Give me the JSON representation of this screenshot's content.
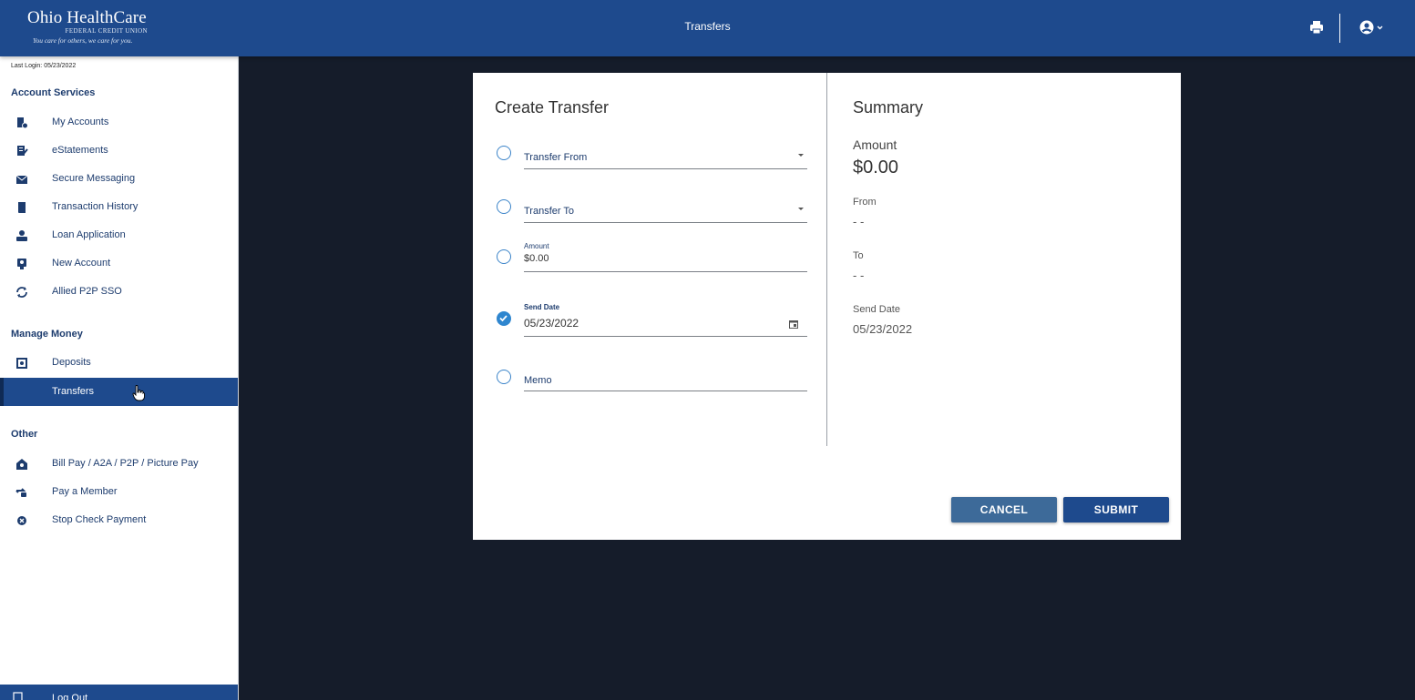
{
  "header": {
    "logo_main": "Ohio HealthCare",
    "logo_sub": "FEDERAL CREDIT UNION",
    "logo_tagline": "You care for others, we care for you.",
    "title": "Transfers",
    "print_icon": "print-icon",
    "account_icon": "account-circle-icon"
  },
  "sidebar": {
    "last_login": "Last Login: 05/23/2022",
    "sections": [
      {
        "title": "Account Services",
        "items": [
          {
            "label": "My Accounts",
            "icon": "accounts-icon"
          },
          {
            "label": "eStatements",
            "icon": "statement-icon"
          },
          {
            "label": "Secure Messaging",
            "icon": "envelope-icon"
          },
          {
            "label": "Transaction History",
            "icon": "book-icon"
          },
          {
            "label": "Loan Application",
            "icon": "loan-icon"
          },
          {
            "label": "New Account",
            "icon": "new-account-icon"
          },
          {
            "label": "Allied P2P SSO",
            "icon": "sync-icon"
          }
        ]
      },
      {
        "title": "Manage Money",
        "items": [
          {
            "label": "Deposits",
            "icon": "safe-icon"
          },
          {
            "label": "Transfers",
            "icon": "",
            "active": true
          }
        ]
      },
      {
        "title": "Other",
        "items": [
          {
            "label": "Bill Pay / A2A / P2P / Picture Pay",
            "icon": "bill-pay-icon"
          },
          {
            "label": "Pay a Member",
            "icon": "pay-member-icon"
          },
          {
            "label": "Stop Check Payment",
            "icon": "stop-icon"
          }
        ]
      }
    ],
    "logout_label": "Log Out"
  },
  "form": {
    "title": "Create Transfer",
    "transfer_from_label": "Transfer From",
    "transfer_to_label": "Transfer To",
    "amount_label": "Amount",
    "amount_value": "$0.00",
    "send_date_label": "Send Date",
    "send_date_value": "05/23/2022",
    "memo_label": "Memo"
  },
  "summary": {
    "title": "Summary",
    "amount_label": "Amount",
    "amount_value": "$0.00",
    "from_label": "From",
    "from_value": "- -",
    "to_label": "To",
    "to_value": "- -",
    "send_date_label": "Send Date",
    "send_date_value": "05/23/2022"
  },
  "buttons": {
    "cancel": "CANCEL",
    "submit": "SUBMIT"
  },
  "colors": {
    "header": "#1e4a8d",
    "background": "#151c2a",
    "accent": "#2f86cf",
    "cancel": "#3d6a99"
  }
}
